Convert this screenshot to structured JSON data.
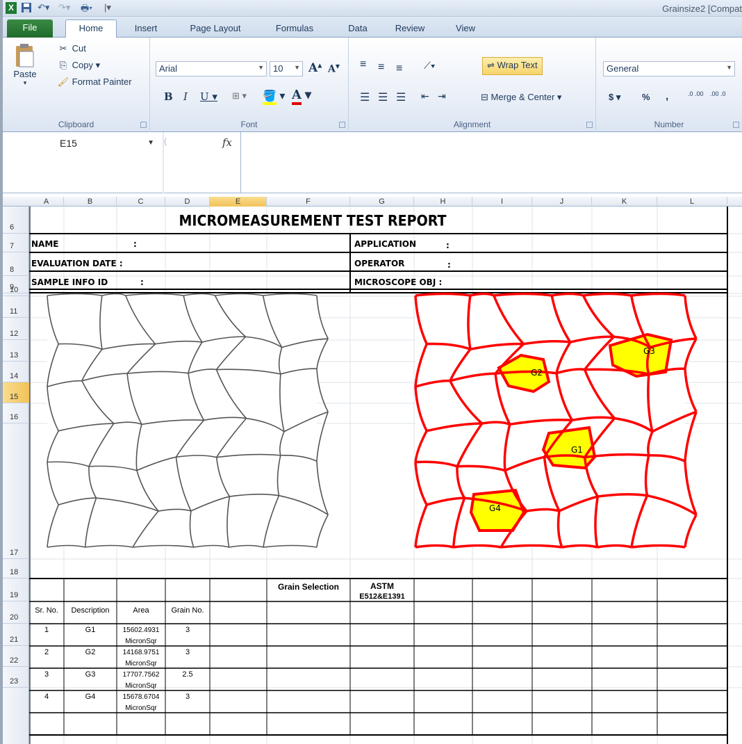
{
  "window": {
    "title": "Grainsize2  [Compat"
  },
  "tabs": [
    "File",
    "Home",
    "Insert",
    "Page Layout",
    "Formulas",
    "Data",
    "Review",
    "View"
  ],
  "clipboard": {
    "paste": "Paste",
    "cut": "Cut",
    "copy": "Copy",
    "format_painter": "Format Painter",
    "label": "Clipboard"
  },
  "font": {
    "name": "Arial",
    "size": "10",
    "label": "Font"
  },
  "alignment": {
    "wrap": "Wrap Text",
    "merge": "Merge & Center",
    "label": "Alignment"
  },
  "number": {
    "format": "General",
    "label": "Number",
    "currency": "$",
    "percent": "%",
    "comma": ",",
    "inc_decimal": ".0 .00",
    "dec_decimal": ".00 .0"
  },
  "formula_bar": {
    "name_box": "E15",
    "fx": "fx",
    "value": ""
  },
  "columns": [
    "A",
    "B",
    "C",
    "D",
    "E",
    "F",
    "G",
    "H",
    "I",
    "J",
    "K",
    "L"
  ],
  "selected_column": "E",
  "rows": [
    "6",
    "7",
    "8",
    "9",
    "10",
    "11",
    "12",
    "13",
    "14",
    "15",
    "16",
    "17",
    "18",
    "19",
    "20",
    "21",
    "22",
    "23"
  ],
  "selected_row": "15",
  "report": {
    "title": "MICROMEASUREMENT  TEST  REPORT",
    "name": "NAME",
    "name_colon": ":",
    "eval_date": "EVALUATION DATE  :",
    "sample": "SAMPLE INFO ID",
    "sample_colon": ":",
    "application": "APPLICATION",
    "app_colon": ":",
    "operator": "OPERATOR",
    "op_colon": ":",
    "microscope": "MICROSCOPE OBJ :",
    "grain_selection": "Grain Selection",
    "astm_line1": "ASTM",
    "astm_line2": "E512&E1391",
    "grain_labels": [
      "G1",
      "G2",
      "G3",
      "G4"
    ]
  },
  "table": {
    "headers": [
      "Sr. No.",
      "Description",
      "Area",
      "Grain No."
    ],
    "rows": [
      {
        "sr": "1",
        "desc": "G1",
        "area": "15602.4931",
        "unit": "MicronSqr",
        "grain": "3"
      },
      {
        "sr": "2",
        "desc": "G2",
        "area": "14168.9751",
        "unit": "MicronSqr",
        "grain": "3"
      },
      {
        "sr": "3",
        "desc": "G3",
        "area": "17707.7562",
        "unit": "MicronSqr",
        "grain": "2.5"
      },
      {
        "sr": "4",
        "desc": "G4",
        "area": "15678.6704",
        "unit": "MicronSqr",
        "grain": "3"
      }
    ]
  },
  "colors": {
    "accent": "#ff0000",
    "highlight": "#ffff00",
    "selection": "#f6c85f",
    "file_tab": "#2a7a36"
  }
}
